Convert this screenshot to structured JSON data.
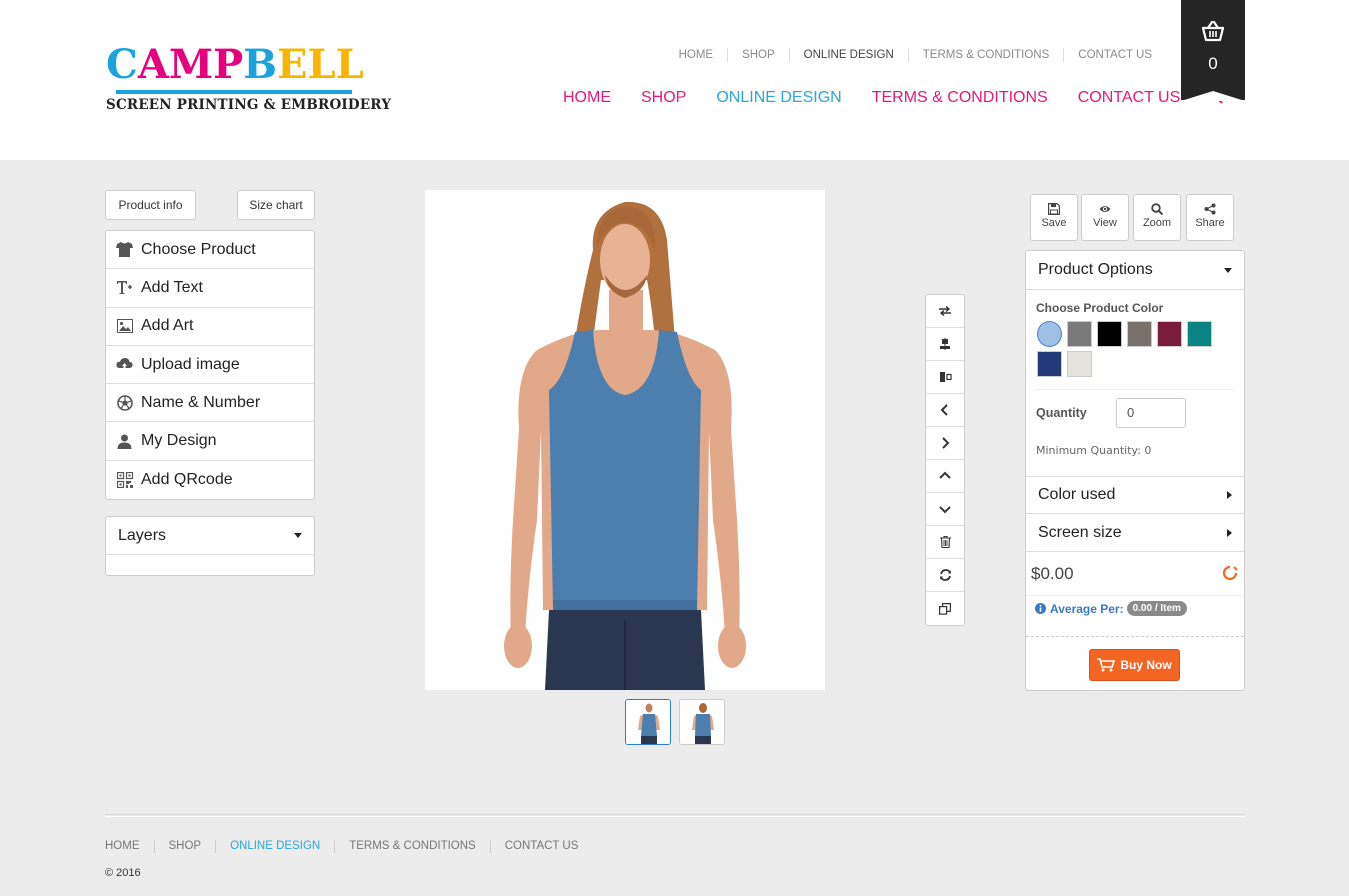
{
  "brand": {
    "name_parts": [
      "C",
      "AMP",
      "B",
      "ELL"
    ],
    "tagline": "SCREEN PRINTING & EMBROIDERY"
  },
  "top_nav_small": [
    "HOME",
    "SHOP",
    "ONLINE DESIGN",
    "TERMS & CONDITIONS",
    "CONTACT US"
  ],
  "main_nav": [
    "HOME",
    "SHOP",
    "ONLINE DESIGN",
    "TERMS & CONDITIONS",
    "CONTACT US"
  ],
  "active_nav": "ONLINE DESIGN",
  "cart": {
    "count": "0"
  },
  "left_panel": {
    "product_info": "Product info",
    "size_chart": "Size chart",
    "menu": [
      {
        "label": "Choose Product",
        "icon": "tshirt-icon"
      },
      {
        "label": "Add Text",
        "icon": "text-icon"
      },
      {
        "label": "Add Art",
        "icon": "image-icon"
      },
      {
        "label": "Upload image",
        "icon": "cloud-upload-icon"
      },
      {
        "label": "Name & Number",
        "icon": "ball-icon"
      },
      {
        "label": "My Design",
        "icon": "user-icon"
      },
      {
        "label": "Add QRcode",
        "icon": "qrcode-icon"
      }
    ],
    "layers_label": "Layers"
  },
  "vertical_tools": [
    "flip-icon",
    "align-center-icon",
    "align-middle-icon",
    "chevron-left-icon",
    "chevron-right-icon",
    "chevron-up-icon",
    "chevron-down-icon",
    "trash-icon",
    "refresh-icon",
    "copy-icon"
  ],
  "actions": [
    {
      "label": "Save",
      "icon": "save-icon"
    },
    {
      "label": "View",
      "icon": "eye-icon"
    },
    {
      "label": "Zoom",
      "icon": "zoom-icon"
    },
    {
      "label": "Share",
      "icon": "share-icon"
    }
  ],
  "product_options": {
    "title": "Product Options",
    "color_label": "Choose Product Color",
    "colors": [
      "#9fc0e6",
      "#7a7a7a",
      "#000000",
      "#7a716c",
      "#7a1c3c",
      "#0b8383",
      "#243a78",
      "#e6e2de"
    ],
    "selected_color_index": 0,
    "quantity_label": "Quantity",
    "quantity_value": "0",
    "min_quantity": "Minimum Quantity: 0",
    "color_used": "Color used",
    "screen_size": "Screen size",
    "price": "$0.00",
    "average_label": "Average Per:",
    "average_value": "0.00 / Item",
    "buy_now": "Buy Now"
  },
  "footer": {
    "nav": [
      "HOME",
      "SHOP",
      "ONLINE DESIGN",
      "TERMS & CONDITIONS",
      "CONTACT US"
    ],
    "copyright": "© 2016"
  },
  "colors": {
    "pink": "#e2197e",
    "blue": "#2aa6d9",
    "shirt": "#4d7fae",
    "orange": "#f26522"
  }
}
